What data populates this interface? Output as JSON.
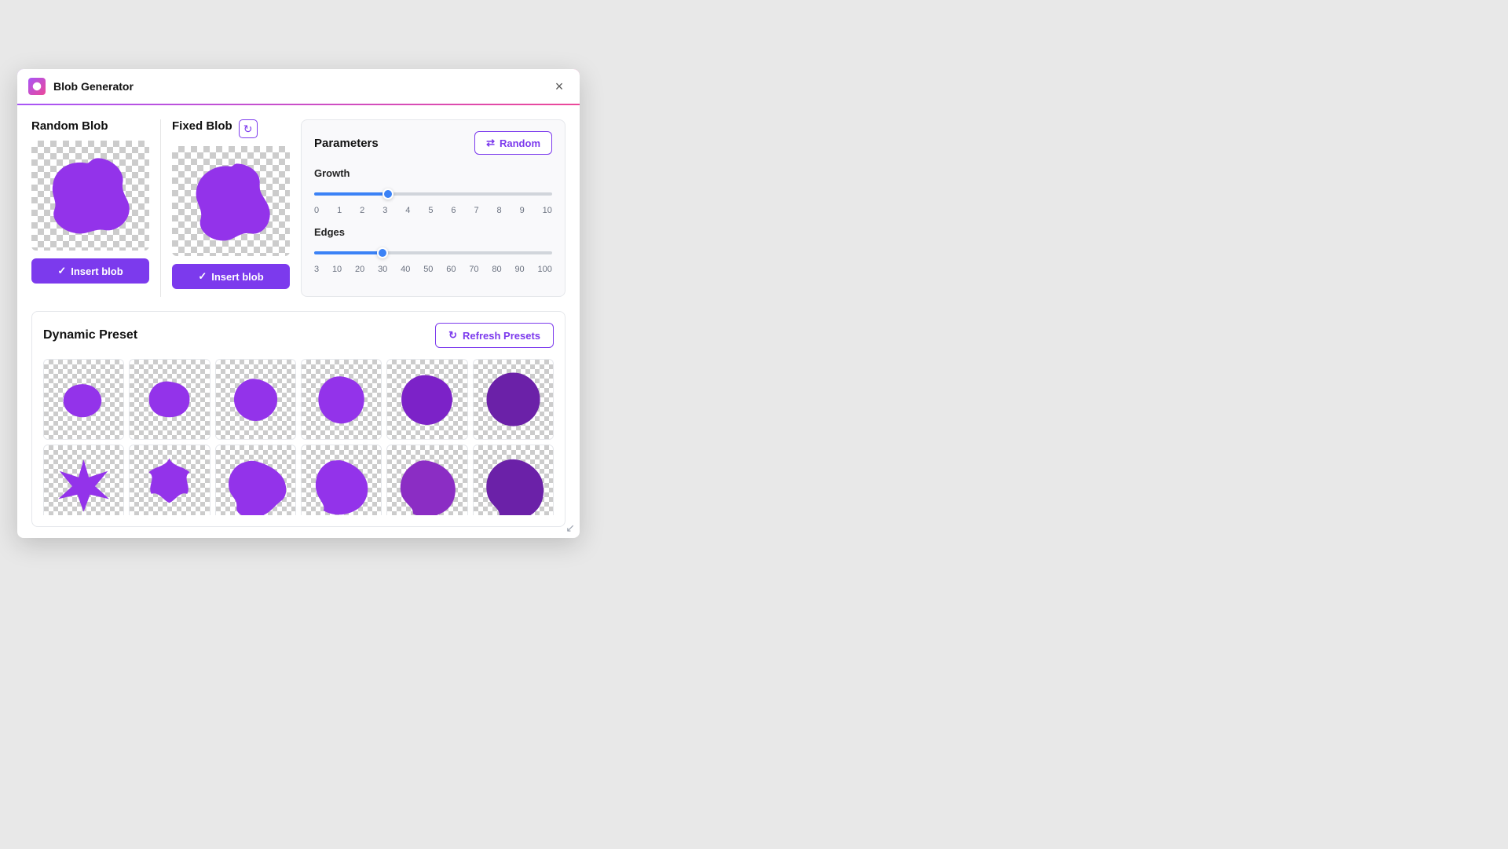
{
  "dialog": {
    "title": "Blob Generator",
    "close_label": "×"
  },
  "random_blob": {
    "title": "Random Blob",
    "insert_label": "Insert blob"
  },
  "fixed_blob": {
    "title": "Fixed Blob",
    "insert_label": "Insert blob"
  },
  "parameters": {
    "title": "Parameters",
    "random_button_label": "Random",
    "growth": {
      "label": "Growth",
      "value": 3,
      "min": 0,
      "max": 10,
      "ticks": [
        "0",
        "1",
        "2",
        "3",
        "4",
        "5",
        "6",
        "7",
        "8",
        "9",
        "10"
      ],
      "fill_percent": 32
    },
    "edges": {
      "label": "Edges",
      "value": 30,
      "min": 3,
      "max": 100,
      "ticks": [
        "3",
        "10",
        "20",
        "30",
        "40",
        "50",
        "60",
        "70",
        "80",
        "90",
        "100"
      ],
      "fill_percent": 30
    }
  },
  "dynamic_preset": {
    "title": "Dynamic Preset",
    "refresh_label": "Refresh Presets"
  },
  "icons": {
    "refresh": "↻",
    "check": "✓",
    "shuffle": "⇄",
    "resize": "↙"
  }
}
